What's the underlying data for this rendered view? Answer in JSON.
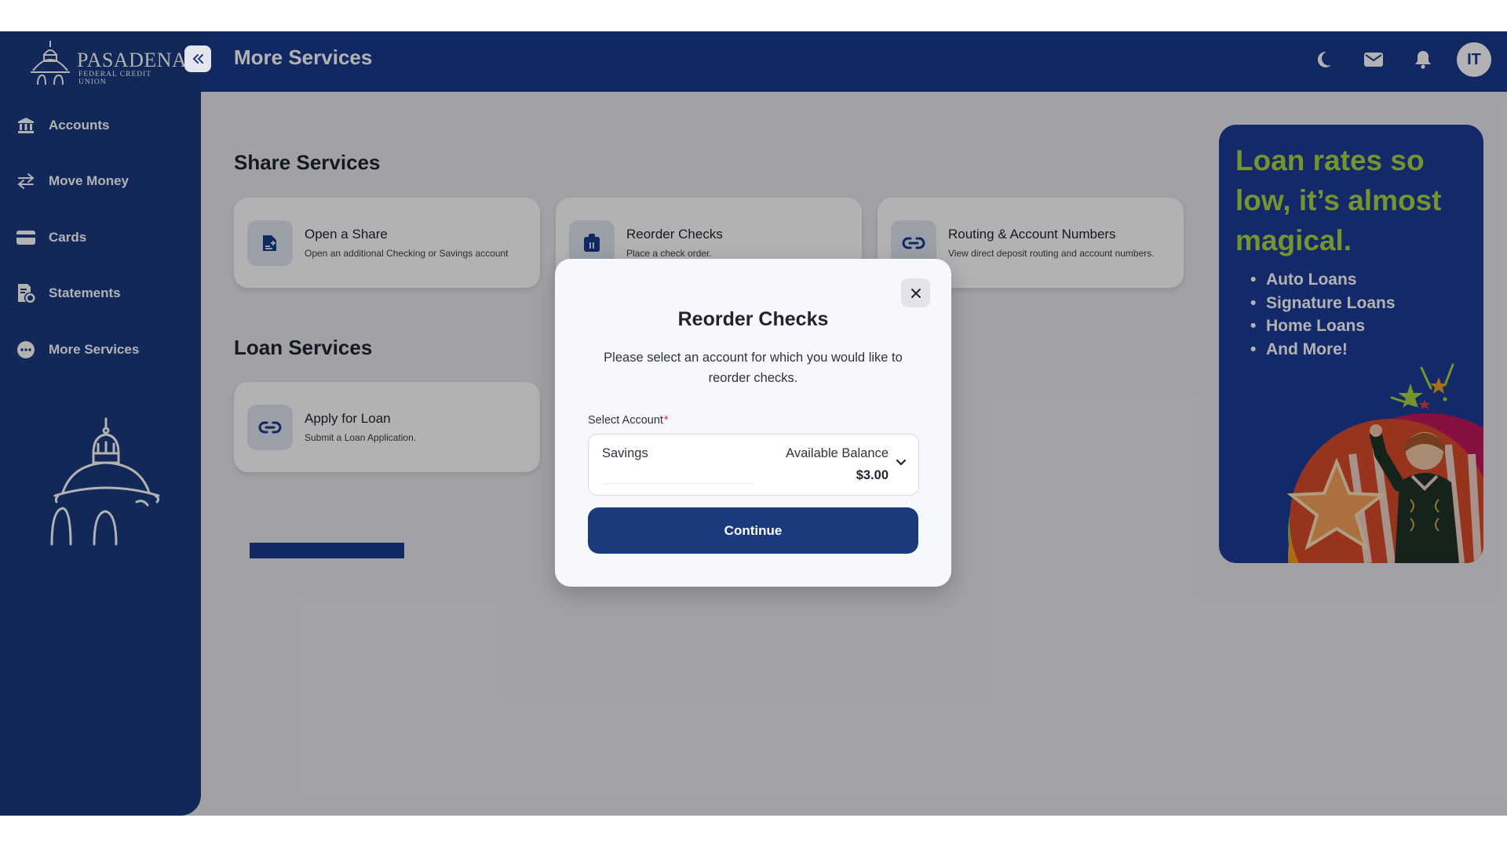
{
  "app": {
    "logo_name": "PASADENA",
    "logo_sub": "FEDERAL CREDIT UNION"
  },
  "sidebar": {
    "collapse_icon": "double-chevron-left-icon",
    "items": [
      {
        "label": "Accounts",
        "icon": "bank-icon"
      },
      {
        "label": "Move Money",
        "icon": "transfer-arrows-icon"
      },
      {
        "label": "Cards",
        "icon": "credit-card-icon"
      },
      {
        "label": "Statements",
        "icon": "statement-icon"
      },
      {
        "label": "More Services",
        "icon": "more-dots-icon"
      }
    ]
  },
  "header": {
    "title": "More Services",
    "icons": [
      "moon-icon",
      "mail-icon",
      "bell-icon"
    ],
    "avatar_initials": "IT"
  },
  "share_services": {
    "title": "Share Services",
    "cards": [
      {
        "title": "Open a Share",
        "desc": "Open an additional Checking or Savings account",
        "icon": "document-plus-icon"
      },
      {
        "title": "Reorder Checks",
        "desc": "Place a check order.",
        "icon": "checkbook-icon"
      },
      {
        "title": "Routing & Account Numbers",
        "desc": "View direct deposit routing and account numbers.",
        "icon": "link-icon"
      }
    ]
  },
  "loan_services": {
    "title": "Loan Services",
    "cards": [
      {
        "title": "Apply for Loan",
        "desc": "Submit a Loan Application.",
        "icon": "link-icon"
      }
    ]
  },
  "promo": {
    "headline": "Loan rates so low, it’s almost magical.",
    "items": [
      "Auto Loans",
      "Signature Loans",
      "Home Loans",
      "And More!"
    ],
    "colors": {
      "background": "#1d3b97",
      "headline": "#a8d342"
    }
  },
  "modal": {
    "title": "Reorder Checks",
    "description": "Please select an account for which you would like to reorder checks.",
    "field_label": "Select Account",
    "required_mark": "*",
    "selected_account": "Savings",
    "balance_label": "Available Balance",
    "balance_value": "$3.00",
    "continue_label": "Continue",
    "close_icon": "close-icon"
  }
}
